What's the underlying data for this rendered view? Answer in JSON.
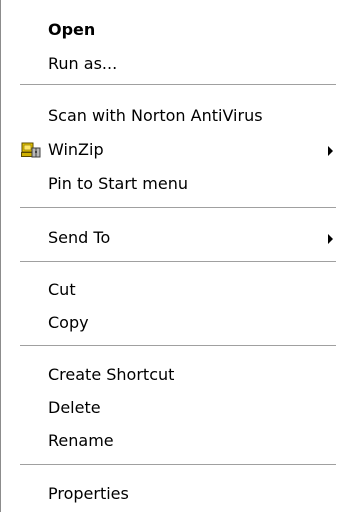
{
  "menu": {
    "items": [
      {
        "label": "Open"
      },
      {
        "label": "Run as..."
      },
      {
        "label": "Scan with Norton AntiVirus"
      },
      {
        "label": "WinZip",
        "icon": "winzip-icon",
        "submenu": true
      },
      {
        "label": "Pin to Start menu"
      },
      {
        "label": "Send To",
        "submenu": true
      },
      {
        "label": "Cut"
      },
      {
        "label": "Copy"
      },
      {
        "label": "Create Shortcut"
      },
      {
        "label": "Delete"
      },
      {
        "label": "Rename"
      },
      {
        "label": "Properties"
      }
    ]
  },
  "colors": {
    "background": "#ffffff",
    "separator": "#a0a0a0",
    "text": "#000000"
  }
}
